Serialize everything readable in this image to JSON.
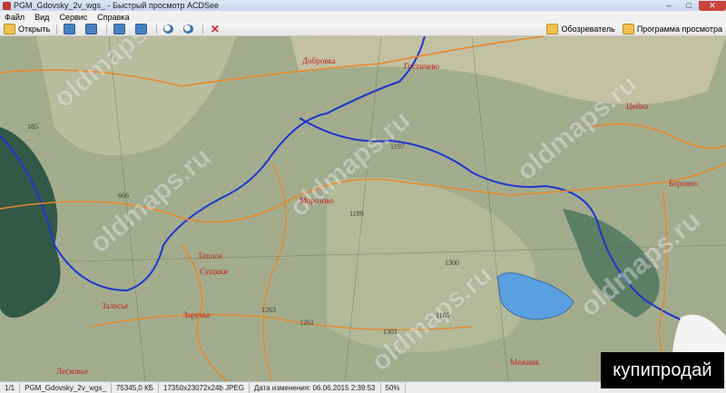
{
  "window": {
    "title": "PGM_Gdovsky_2v_wgs_ - Быстрый просмотр ACDSee",
    "minimize": "–",
    "maximize": "□",
    "close": "✕"
  },
  "menu": [
    "Файл",
    "Вид",
    "Сервис",
    "Справка"
  ],
  "toolbar": {
    "open_label": "Открыть",
    "browser_label": "Обозреватель",
    "viewer_label": "Программа просмотра"
  },
  "map": {
    "places": [
      {
        "text": "Добровка"
      },
      {
        "text": "Гостичево"
      },
      {
        "text": "Морозово"
      },
      {
        "text": "Боровно"
      },
      {
        "text": "Теплое"
      },
      {
        "text": "Сущики"
      },
      {
        "text": "Заручье"
      },
      {
        "text": "Залесье"
      },
      {
        "text": "Цейна"
      },
      {
        "text": "Лесковье"
      },
      {
        "text": "Межник"
      }
    ],
    "numbers": [
      "185",
      "666",
      "1197",
      "1199",
      "1300",
      "1165",
      "1261",
      "1263",
      "1301"
    ],
    "watermark": "oldmaps.ru"
  },
  "status": {
    "page": "1/1",
    "file": "PGM_Gdovsky_2v_wgs_",
    "size": "75345,0 КБ",
    "dims": "17350x23072x24b JPEG",
    "modified": "Дата изменения: 06.06.2015 2:39:53",
    "zoom": "50%"
  },
  "badge": "купипродай",
  "colors": {
    "map_bg": "#a3ad8e",
    "river": "#2233d0",
    "roads": "#e8872a",
    "lake": "#5a9fe0",
    "forest": "#1f4a3a"
  }
}
